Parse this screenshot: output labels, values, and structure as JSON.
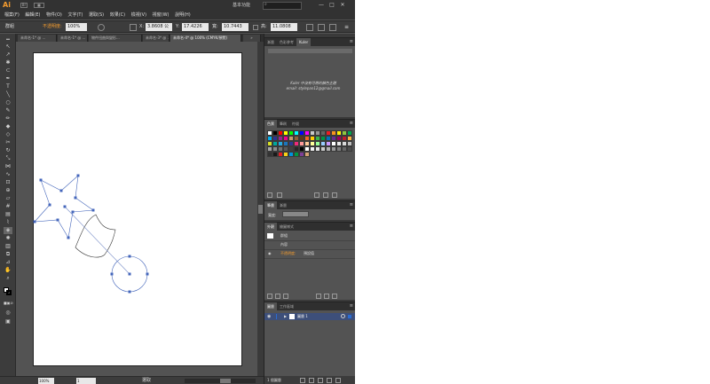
{
  "titlebar": {
    "app_logo": "Ai",
    "bridge_label": "Br",
    "workspace_label": "基本功能",
    "search_placeholder": "",
    "search_icon": "search-icon",
    "minimize": "—",
    "maximize": "□",
    "close": "✕"
  },
  "menubar": {
    "items": [
      "檔案(F)",
      "編輯(E)",
      "物件(O)",
      "文字(T)",
      "選取(S)",
      "效果(C)",
      "檢視(V)",
      "視窗(W)",
      "說明(H)"
    ]
  },
  "controlbar": {
    "selection_label": "群組",
    "opacity_label": "不透明度:",
    "opacity_value": "100%",
    "x_label": "X:",
    "x_value": "3.8608 公",
    "y_label": "Y:",
    "y_value": "17.4226",
    "w_label": "寬:",
    "w_value": "10.7443",
    "h_label": "高:",
    "h_value": "11.0808"
  },
  "tabs": [
    {
      "label": "未命名-1* @ ..."
    },
    {
      "label": "未命名-1* @ ..."
    },
    {
      "label": "物件扭曲與變形..."
    },
    {
      "label": "未命名-3* @ ..."
    },
    {
      "label": "未命名-4* @ 100% (CMYK/預覽)"
    }
  ],
  "statusbar": {
    "zoom": "100%",
    "page": "1",
    "status_text": "選取"
  },
  "panels": {
    "kuler": {
      "tabs": [
        "漸層",
        "色彩參考",
        "Kuler"
      ],
      "active": "Kuler",
      "message_line1": "Kuler 中沒有可用的顏色主題",
      "message_line2": "email: stylepan12@gmail.com"
    },
    "swatches": {
      "tabs": [
        "色票",
        "筆刷",
        "符號"
      ],
      "active": "色票"
    },
    "stroke": {
      "tabs": [
        "筆畫",
        "漸層"
      ],
      "weight_label": "寬度:",
      "weight_value": ""
    },
    "appearance": {
      "tabs": [
        "外觀",
        "繪圖樣式"
      ],
      "rows": [
        {
          "label": "群組"
        },
        {
          "label": "內容"
        },
        {
          "label": "不透明度:",
          "value": "預設值"
        }
      ]
    },
    "layers": {
      "tabs": [
        "圖層",
        "工作區域"
      ],
      "layer_name": "圖層 1",
      "footer": "1 個圖層"
    }
  },
  "colors": {
    "app_bg": "#535353",
    "dark_bar": "#323232",
    "accent": "#f29b2f",
    "path_stroke": "#4466bb",
    "layer_highlight": "#3d4f7a"
  },
  "swatch_colors": [
    "#ffffff",
    "#000000",
    "#ff0000",
    "#ffff00",
    "#00ff00",
    "#00ffff",
    "#0000ff",
    "#ff00ff",
    "#c8c8c8",
    "#969696",
    "#646464",
    "#ed1c24",
    "#f7941d",
    "#fff200",
    "#8dc63f",
    "#00a651",
    "#00aeef",
    "#2e3192",
    "#92278f",
    "#ec008c",
    "#c69c6d",
    "#8c6239",
    "#603913",
    "#f26522",
    "#ffcc00",
    "#39b54a",
    "#009444",
    "#0072bc",
    "#662d91",
    "#9e005d",
    "#be1e2d",
    "#fbb040",
    "#d7df23",
    "#00a79d",
    "#27aae1",
    "#1c75bc",
    "#2b3990",
    "#ee2a7b",
    "#ff9999",
    "#ffcc99",
    "#ffff99",
    "#99ff99",
    "#99ccff",
    "#cc99ff",
    "#ffffff",
    "#ebebeb",
    "#d9d9d9",
    "#bfbfbf",
    "#a6a6a6",
    "#8c8c8c",
    "#737373",
    "#595959",
    "#404040",
    "#262626",
    "#000000",
    "#ffffff",
    "#f2f2f2",
    "#e6e6e6",
    "#cccccc",
    "#b3b3b3",
    "#999999",
    "#808080",
    "#666666",
    "#4d4d4d",
    "#333333",
    "#1a1a1a",
    "#e31e24",
    "#f7d117",
    "#0093dd",
    "#009640",
    "#7f3f98",
    "#d4a373"
  ]
}
